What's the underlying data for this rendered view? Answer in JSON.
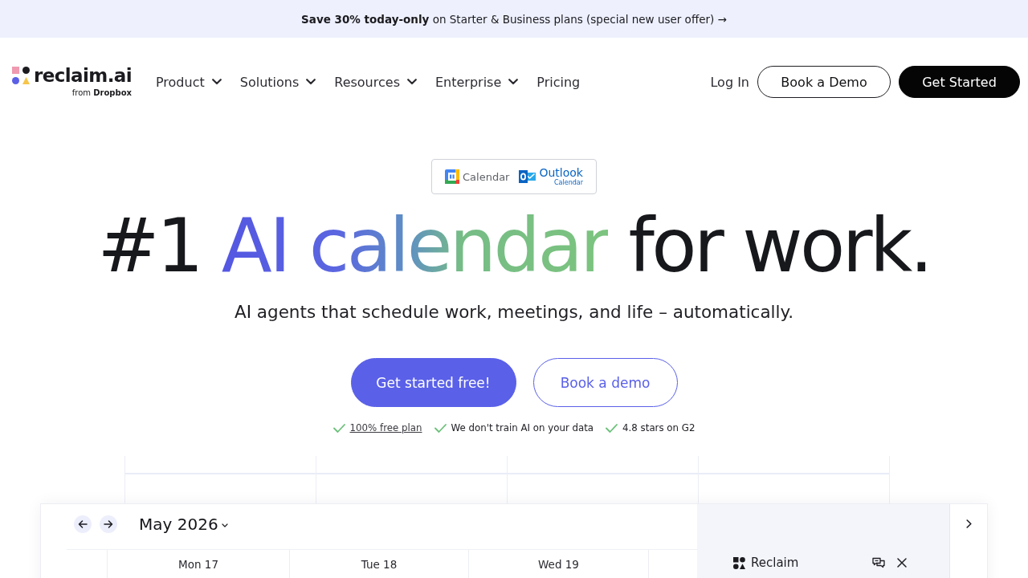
{
  "promo_banner": {
    "text": "**Save 30% today-only** on Starter & Business plans (special new user offer) →"
  },
  "nav": {
    "logo": {
      "wordmark": "reclaim.ai",
      "byline": "from **Dropbox**"
    },
    "menu": [
      {
        "label": "Product",
        "kind": "dropdown"
      },
      {
        "label": "Solutions",
        "kind": "dropdown"
      },
      {
        "label": "Resources",
        "kind": "dropdown"
      },
      {
        "label": "Enterprise",
        "kind": "dropdown"
      },
      {
        "label": "Pricing",
        "kind": "link"
      }
    ],
    "login": "Log In",
    "buttons": [
      {
        "label": "Book a Demo",
        "kind": "outline"
      },
      {
        "label": "Get Started",
        "kind": "filled"
      }
    ]
  },
  "hero": {
    "integrations": [
      {
        "label": "Calendar",
        "kind": "calendar"
      },
      {
        "label": "Outlook",
        "sublabel": "Calendar",
        "kind": "mail"
      }
    ],
    "heading": [
      {
        "text": "#1 ",
        "kind": "plain"
      },
      {
        "text": "AI calendar",
        "kind": "gradient"
      },
      {
        "text": " for work.",
        "kind": "plain"
      }
    ],
    "subtitle": "AI agents that schedule work, meetings, and life – automatically.",
    "buttons": [
      {
        "label": "Get started free!",
        "kind": "filled"
      },
      {
        "label": "Book a demo",
        "kind": "outline"
      }
    ],
    "highlights": [
      {
        "text": "100% free plan",
        "kind": "link"
      },
      {
        "text": "We don't train AI on your data",
        "kind": "plain"
      },
      {
        "text": "4.8 stars on G2",
        "kind": "plain"
      }
    ]
  },
  "calendar_preview": {
    "month": "May 2026",
    "days": [
      "Mon 17",
      "Tue 18",
      "Wed 19"
    ],
    "panel": {
      "title": "Reclaim"
    }
  }
}
